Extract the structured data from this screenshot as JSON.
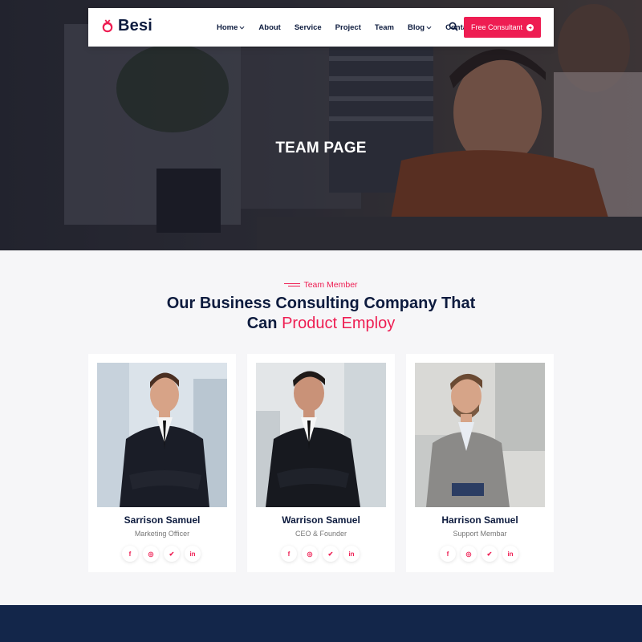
{
  "brand": {
    "name": "Besi",
    "accent": "#ee1d52",
    "navy": "#0d1b3e"
  },
  "nav": {
    "items": [
      {
        "label": "Home",
        "dropdown": true
      },
      {
        "label": "About",
        "dropdown": false
      },
      {
        "label": "Service",
        "dropdown": false
      },
      {
        "label": "Project",
        "dropdown": false
      },
      {
        "label": "Team",
        "dropdown": false
      },
      {
        "label": "Blog",
        "dropdown": true
      },
      {
        "label": "Contact",
        "dropdown": false
      }
    ],
    "search_icon": "search-icon",
    "cta_label": "Free Consultant"
  },
  "hero": {
    "title": "TEAM PAGE"
  },
  "section": {
    "sub_label": "Team Member",
    "heading_line1": "Our Business Consulting Company That",
    "heading_line2_prefix": "Can ",
    "heading_line2_accent": "Product Employ"
  },
  "team": [
    {
      "name": "Sarrison Samuel",
      "role": "Marketing Officer"
    },
    {
      "name": "Warrison Samuel",
      "role": "CEO & Founder"
    },
    {
      "name": "Harrison Samuel",
      "role": "Support Membar"
    }
  ],
  "social_icons": [
    "facebook-icon",
    "instagram-icon",
    "twitter-icon",
    "linkedin-icon"
  ]
}
